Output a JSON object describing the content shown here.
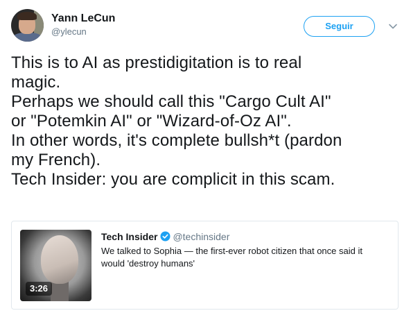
{
  "author": {
    "name": "Yann LeCun",
    "handle": "@ylecun"
  },
  "follow_button_label": "Seguir",
  "tweet_lines": [
    "This is to AI as prestidigitation is to real",
    "magic.",
    "Perhaps we should call this \"Cargo Cult AI\"",
    "or \"Potemkin AI\" or \"Wizard-of-Oz AI\".",
    "In other words, it's complete bullsh*t (pardon",
    "my French).",
    "Tech Insider: you are complicit in this scam."
  ],
  "quoted_tweet": {
    "name": "Tech Insider",
    "handle": "@techinsider",
    "verified": true,
    "text_lines": [
      "We talked to Sophia — the first-ever robot citizen that once said it",
      "would 'destroy humans'"
    ],
    "video_duration": "3:26"
  },
  "colors": {
    "accent": "#1da1f2",
    "text": "#14171a",
    "secondary": "#657786",
    "border": "#e1e8ed"
  },
  "icons": {
    "caret": "chevron-down-icon",
    "verified": "verified-badge-icon"
  }
}
